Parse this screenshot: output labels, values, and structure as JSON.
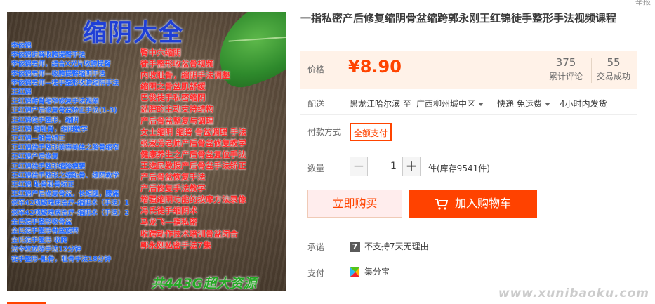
{
  "product_image": {
    "title": "缩阴大全",
    "left_lines": [
      "李依锦",
      "李依锦讲解收胯提臀手法",
      "李依锦老师，结合X光片收胯提臀",
      "李依锦老师—收胯提臀缩阴手法",
      "李依锦老师—徒手整形收胯缩阴手法",
      "王红锦",
      "王红锦跨骨缩窄修复手法视频",
      "王红锦产后修复骨盆矫正手法(1-3)",
      "王红锦徒手整形，缩阴",
      "王红锦 缩耻骨，缩阴教学",
      "王红锦—骶骨矫正",
      "王红锦徒手整形美容美体之胯骨缩窄",
      "王红锦产后修复",
      "王红锦徒手整形缩胯瘦腰",
      "王红锦徒手整形之缩耻骨、缩阴教学",
      "王红锦 耻骨耻骨矫正",
      "王红锦产后修复骨盆，长短腿，腰痛",
      "张军42项疑难病治疗-缩阴术（手法）1",
      "张军42项疑难病治疗-缩阴术（手法）2",
      "全氏徒手整形收骨盆",
      "全氏徒手整形骨盆旋转",
      "全氏徒手整形 收胯",
      "法令纹祛除手法12分钟",
      "徒手整形-骶骨，耻骨手法18分钟"
    ],
    "right_lines": [
      "臀中穴缩阴",
      "徒手整形收盆骨视频",
      "内收耻骨，缩阴手法调整",
      "缩阴之骨盆肌舒缓",
      "巴俊徒手私密缩阴",
      "盆腔的主动支持结构",
      "产后骨盆整复与调理",
      "女士缩阴 缩胯 骨盆调理 手法",
      "张淑芳老师产后骨盆修复教学",
      "健康养生之产后骨盆复位手法",
      "王选民教授产后骨盆手法矫正",
      "产后骨盆恢复手法",
      "产后修复手法教学",
      "增强缩阴功能的按摩方法录像",
      "冯氏徒手缩阴术",
      "马龙飞—指私密",
      "收跨动作技术培训骨盆闭合",
      "郭永刚私密手法7集"
    ],
    "bottom_text": "共443G超大资源"
  },
  "product": {
    "title": "一指私密产后修复缩阴骨盆缩跨郭永刚王红锦徒手整形手法视频课程",
    "top_right": "举报"
  },
  "price": {
    "label": "价格",
    "value": "¥8.90",
    "reviews_count": "375",
    "reviews_label": "累计评论",
    "deals_count": "55",
    "deals_label": "交易成功"
  },
  "shipping": {
    "label": "配送",
    "from": "黑龙江哈尔滨 至",
    "to": "广西柳州城中区",
    "method": "快递 免运费",
    "dispatch": "4小时内发货"
  },
  "payment": {
    "label": "付款方式",
    "option": "全额支付"
  },
  "quantity": {
    "label": "数量",
    "minus": "−",
    "value": "1",
    "plus": "+",
    "unit_stock": "件(库存9541件)"
  },
  "buttons": {
    "buy_now": "立即购买",
    "add_cart": "加入购物车"
  },
  "promise": {
    "label": "承诺",
    "icon_glyph": "7",
    "text": "不支持7天无理由"
  },
  "pay": {
    "label": "支付",
    "text": "集分宝"
  },
  "watermark": "www.xunibaoku.com",
  "colors": {
    "accent": "#ff4400",
    "price_bg": "#fff2e8"
  }
}
